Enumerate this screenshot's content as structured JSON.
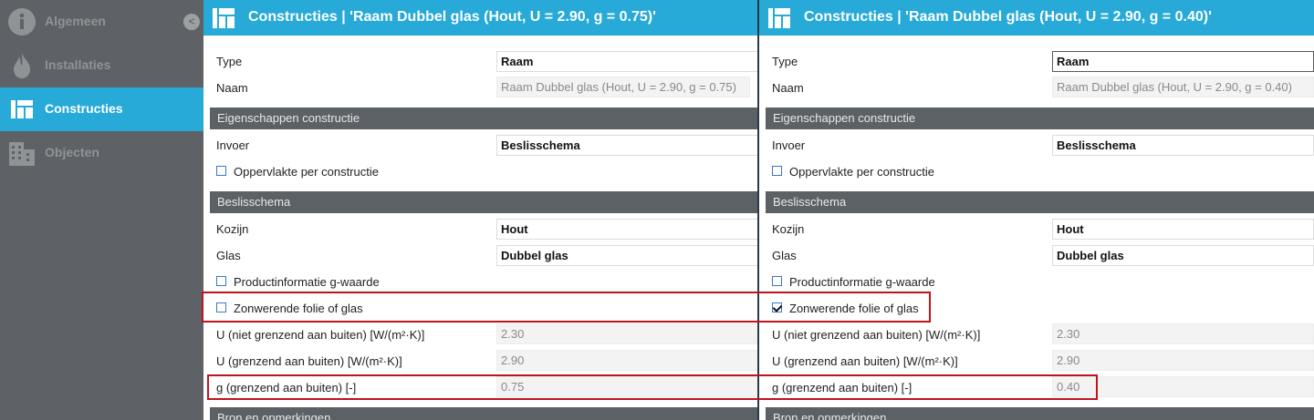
{
  "sidebar": {
    "collapse_glyph": "<",
    "items": [
      {
        "label": "Algemeen",
        "icon": "info-icon",
        "active": false
      },
      {
        "label": "Installaties",
        "icon": "flame-icon",
        "active": false
      },
      {
        "label": "Constructies",
        "icon": "construction-icon",
        "active": true
      },
      {
        "label": "Objecten",
        "icon": "building-icon",
        "active": false
      }
    ]
  },
  "left": {
    "title": "Constructies | 'Raam Dubbel glas (Hout, U = 2.90, g = 0.75)'",
    "type_label": "Type",
    "type_value": "Raam",
    "naam_label": "Naam",
    "naam_value": "Raam Dubbel glas (Hout, U = 2.90, g = 0.75)",
    "section_eigenschappen": "Eigenschappen constructie",
    "invoer_label": "Invoer",
    "invoer_value": "Beslisschema",
    "oppervlakte_label": "Oppervlakte per constructie",
    "oppervlakte_checked": false,
    "section_beslisschema": "Beslisschema",
    "kozijn_label": "Kozijn",
    "kozijn_value": "Hout",
    "glas_label": "Glas",
    "glas_value": "Dubbel glas",
    "productinfo_label": "Productinformatie g-waarde",
    "productinfo_checked": false,
    "zonwerende_label": "Zonwerende folie of glas",
    "zonwerende_checked": false,
    "u_niet_label": "U (niet grenzend aan buiten) [W/(m²·K)]",
    "u_niet_value": "2.30",
    "u_grenzend_label": "U (grenzend aan buiten) [W/(m²·K)]",
    "u_grenzend_value": "2.90",
    "g_label": "g (grenzend aan buiten) [-]",
    "g_value": "0.75",
    "section_bron": "Bron en opmerkingen"
  },
  "right": {
    "title": "Constructies | 'Raam Dubbel glas (Hout, U = 2.90, g = 0.40)'",
    "type_label": "Type",
    "type_value": "Raam",
    "naam_label": "Naam",
    "naam_value": "Raam Dubbel glas (Hout, U = 2.90, g = 0.40)",
    "section_eigenschappen": "Eigenschappen constructie",
    "invoer_label": "Invoer",
    "invoer_value": "Beslisschema",
    "oppervlakte_label": "Oppervlakte per constructie",
    "oppervlakte_checked": false,
    "section_beslisschema": "Beslisschema",
    "kozijn_label": "Kozijn",
    "kozijn_value": "Hout",
    "glas_label": "Glas",
    "glas_value": "Dubbel glas",
    "productinfo_label": "Productinformatie g-waarde",
    "productinfo_checked": false,
    "zonwerende_label": "Zonwerende folie of glas",
    "zonwerende_checked": true,
    "u_niet_label": "U (niet grenzend aan buiten) [W/(m²·K)]",
    "u_niet_value": "2.30",
    "u_grenzend_label": "U (grenzend aan buiten) [W/(m²·K)]",
    "u_grenzend_value": "2.90",
    "g_label": "g (grenzend aan buiten) [-]",
    "g_value": "0.40",
    "section_bron": "Bron en opmerkingen"
  },
  "colors": {
    "accent": "#27aad8",
    "sidebar_bg": "#5e6266",
    "section_bg": "#5c6166",
    "highlight": "#c0141c"
  }
}
